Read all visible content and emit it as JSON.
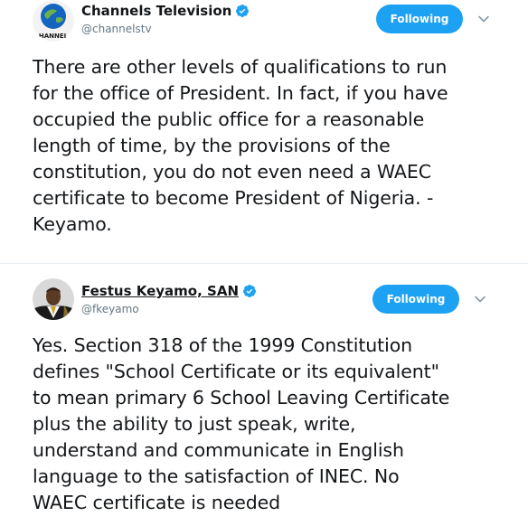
{
  "tweets": [
    {
      "author": {
        "display_name": "Channels Television",
        "handle": "@channelstv",
        "verified": true,
        "avatar_icon": "channels-tv-logo",
        "avatar_caption": "HANNEL"
      },
      "follow_label": "Following",
      "text": "There are other levels of qualifications to run\nfor the office of  President. In fact, if you have\noccupied the public office for a  reasonable\nlength of time, by the provisions of the\nconstitution, you do not even need a WAEC\ncertificate to become President of Nigeria. -\nKeyamo."
    },
    {
      "author": {
        "display_name": "Festus Keyamo, SAN",
        "handle": "@fkeyamo",
        "verified": true,
        "avatar_icon": "portrait-photo"
      },
      "follow_label": "Following",
      "text": "Yes. Section 318 of the 1999 Constitution\ndefines \"School Certificate or its equivalent\"\nto mean primary 6 School Leaving Certificate\nplus the ability to just speak, write,\nunderstand and communicate in English\nlanguage to the satisfaction of INEC. No\nWAEC certificate is needed"
    }
  ],
  "colors": {
    "accent": "#1da1f2",
    "text": "#14171a",
    "secondary_text": "#657786"
  }
}
